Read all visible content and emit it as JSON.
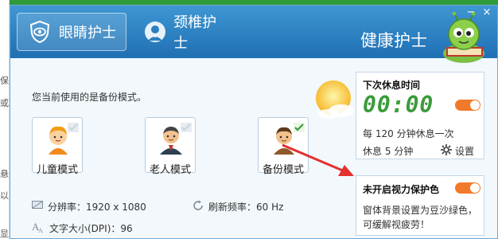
{
  "header": {
    "tabs": [
      {
        "label": "眼睛护士",
        "icon": "eye-shield-icon"
      },
      {
        "label": "颈椎护士",
        "icon": "neck-person-icon"
      }
    ],
    "brand": "健康护士",
    "mascot": "green-caterpillar-mascot-icon",
    "window_buttons": {
      "minimize": "−",
      "close": "×"
    }
  },
  "main": {
    "hint": "您当前使用的是备份模式。",
    "modes": [
      {
        "label": "儿童模式",
        "icon": "child-face-icon",
        "selected": false
      },
      {
        "label": "老人模式",
        "icon": "elder-face-icon",
        "selected": false
      },
      {
        "label": "备份模式",
        "icon": "backup-face-icon",
        "selected": true
      }
    ],
    "info": {
      "resolution": "分辨率：1920 x 1080",
      "refresh": "刷新频率：60 Hz",
      "dpi": "文字大小(DPI)：96"
    }
  },
  "rest_panel": {
    "title": "下次休息时间",
    "clock": "00:00",
    "interval_prefix": "每",
    "interval_value": "120",
    "interval_suffix": "分钟休息一次",
    "rest_prefix": "休息",
    "rest_value": "5",
    "rest_suffix": "分钟",
    "settings": "设置"
  },
  "protect_panel": {
    "title": "未开启视力保护色",
    "desc_line1": "窗体背景设置为豆沙绿色，",
    "desc_line2": "可缓解视疲劳！"
  },
  "background": {
    "fragments": [
      "保",
      "或",
      "悬",
      "以",
      "显"
    ]
  },
  "colors": {
    "header": "#2a80c2",
    "accent_orange": "#f07a2a",
    "clock_green": "#3a9b3a",
    "arrow_red": "#e53030"
  }
}
